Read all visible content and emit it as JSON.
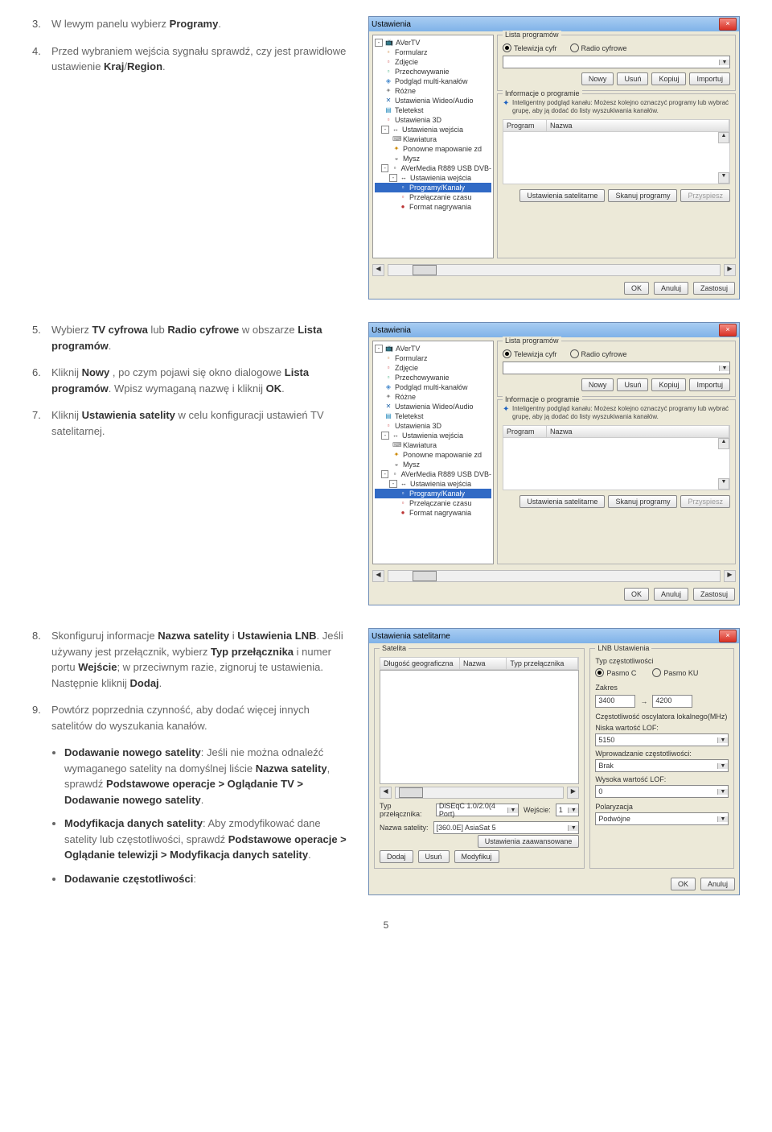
{
  "steps": {
    "s3": {
      "num": "3.",
      "text_a": "W lewym panelu wybierz ",
      "b1": "Programy",
      "text_b": "."
    },
    "s4": {
      "num": "4.",
      "text_a": "Przed wybraniem wejścia sygnału sprawdź, czy jest prawidłowe ustawienie ",
      "b1": "Kraj",
      "sep": "/",
      "b2": "Region",
      "dot": "."
    },
    "s5": {
      "num": "5.",
      "text_a": "Wybierz ",
      "b1": "TV cyfrowa",
      "text_b": " lub ",
      "b2": "Radio cyfrowe",
      "text_c": " w obszarze ",
      "b3": "Lista programów",
      "dot": "."
    },
    "s6": {
      "num": "6.",
      "text_a": "Kliknij ",
      "b1": "Nowy",
      "text_b": " , po czym pojawi się okno dialogowe ",
      "b2": "Lista programów",
      "text_c": ". Wpisz wymaganą nazwę i kliknij ",
      "b3": "OK",
      "dot": "."
    },
    "s7": {
      "num": "7.",
      "text_a": "Kliknij ",
      "b1": "Ustawienia satelity",
      "text_b": " w celu konfiguracji ustawień TV satelitarnej."
    },
    "s8": {
      "num": "8.",
      "text_a": "Skonfiguruj informacje ",
      "b1": "Nazwa satelity",
      "text_b": " i ",
      "b2": "Ustawienia LNB",
      "text_c": ". Jeśli używany jest przełącznik, wybierz ",
      "b3": "Typ przełącznika",
      "text_d": " i numer portu ",
      "b4": "Wejście",
      "text_e": "; w przeciwnym razie, zignoruj te ustawienia. Następnie kliknij ",
      "b5": "Dodaj",
      "dot": "."
    },
    "s9": {
      "num": "9.",
      "text": "Powtórz poprzednia czynność, aby dodać więcej innych satelitów do wyszukania kanałów."
    }
  },
  "bullets": {
    "b1": {
      "t1": "Dodawanie nowego satelity",
      "body_a": ": Jeśli nie można odnaleźć wymaganego satelity na domyślnej liście ",
      "b2": "Nazwa satelity",
      "body_b": ", sprawdź ",
      "b3": "Podstawowe operacje > Oglądanie TV > Dodawanie nowego satelity",
      "dot": "."
    },
    "b2": {
      "t1": "Modyfikacja danych satelity",
      "body_a": ": Aby zmodyfikować dane satelity lub częstotliwości, sprawdź ",
      "b2": "Podstawowe operacje > Oglądanie telewizji > Modyfikacja danych satelity",
      "dot": "."
    },
    "b3": {
      "t1": "Dodawanie częstotliwości",
      "colon": ":"
    }
  },
  "dialog": {
    "title": "Ustawienia",
    "tree": {
      "root": "AVerTV",
      "items": [
        "Formularz",
        "Zdjęcie",
        "Przechowywanie",
        "Podgląd multi-kanałów",
        "Różne",
        "Ustawienia Wideo/Audio",
        "Teletekst",
        "Ustawienia 3D",
        "Ustawienia wejścia",
        "Klawiatura",
        "Ponowne mapowanie zd",
        "Mysz",
        "AVerMedia R889 USB DVB-",
        "Ustawienia wejścia",
        "Programy/Kanały",
        "Przełączanie czasu",
        "Format nagrywania"
      ]
    },
    "lista_label": "Lista programów",
    "radio_tv": "Telewizja cyfr",
    "radio_radio": "Radio cyfrowe",
    "btn_nowy": "Nowy",
    "btn_usun": "Usuń",
    "btn_kopiuj": "Kopiuj",
    "btn_importuj": "Importuj",
    "info_label": "Informacje o programie",
    "info_text": "Inteligentny podgląd kanału: Możesz kolejno oznaczyć programy lub wybrać grupę, aby ją dodać do listy wyszukiwania kanałów.",
    "col_program": "Program",
    "col_nazwa": "Nazwa",
    "btn_sat": "Ustawienia satelitarne",
    "btn_skan": "Skanuj programy",
    "btn_przysp": "Przyspiesz",
    "ok": "OK",
    "anuluj": "Anuluj",
    "zastosuj": "Zastosuj"
  },
  "sat_dialog": {
    "title": "Ustawienia satelitarne",
    "grp_sat": "Satelita",
    "col_dl": "Długość geograficzna",
    "col_nz": "Nazwa",
    "col_tp": "Typ przełącznika",
    "lbl_typ": "Typ przełącznika:",
    "val_typ": "DiSEqC 1.0/2.0(4 Port)",
    "lbl_wej": "Wejście:",
    "val_wej": "1",
    "lbl_nazwa": "Nazwa satelity:",
    "val_nazwa": "[360.0E] AsiaSat 5",
    "btn_adv": "Ustawienia zaawansowane",
    "btn_dodaj": "Dodaj",
    "btn_usun": "Usuń",
    "btn_mod": "Modyfikuj",
    "grp_lnb": "LNB Ustawienia",
    "lbl_czest": "Typ częstotliwości",
    "r_pasmoc": "Pasmo C",
    "r_pasmoku": "Pasmo KU",
    "lbl_zakres": "Zakres",
    "z1": "3400",
    "zd": "→",
    "z2": "4200",
    "lbl_osc": "Częstotliwość oscylatora lokalnego(MHz)",
    "lbl_niska": "Niska wartość LOF:",
    "v_niska": "5150",
    "lbl_wprow": "Wprowadzanie częstotliwości:",
    "v_wprow": "Brak",
    "lbl_wys": "Wysoka wartość LOF:",
    "v_wys": "0",
    "lbl_pol": "Polaryzacja",
    "v_pol": "Podwójne",
    "ok": "OK",
    "anuluj": "Anuluj"
  },
  "page_num": "5"
}
